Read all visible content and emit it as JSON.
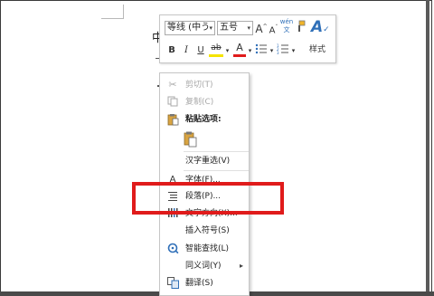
{
  "colors": {
    "highlight": "#e01b1b",
    "styles_accent": "#2f6fb8",
    "font_color_underline": "#e01b1b",
    "highlight_color_underline": "#f5e400"
  },
  "document": {
    "visible_char": "中"
  },
  "mini_toolbar": {
    "font_name": "等线 (中う",
    "font_size": "五号",
    "grow_font_icon": "A",
    "shrink_font_icon": "A",
    "phonetic_icon": "wén文",
    "format_painter_icon": "brush-icon",
    "styles_label": "样式",
    "bold": "B",
    "italic": "I",
    "underline": "U",
    "highlight_icon": "ab",
    "font_color_icon": "A",
    "bullets_icon": "bullets-icon",
    "numbering_icon": "numbering-icon"
  },
  "context_menu": {
    "items": [
      {
        "label": "剪切(T)",
        "icon": "cut-icon",
        "disabled": true
      },
      {
        "label": "复制(C)",
        "icon": "copy-icon",
        "disabled": true
      },
      {
        "label": "粘贴选项:",
        "icon": "paste-icon",
        "bold": true
      },
      {
        "label": "",
        "icon": "paste-keep-text-icon"
      },
      {
        "label": "汉字重选(V)",
        "icon": ""
      },
      {
        "label": "字体(F)...",
        "icon": "font-icon"
      },
      {
        "label": "段落(P)...",
        "icon": "paragraph-icon"
      },
      {
        "label": "文字方向(X)...",
        "icon": "text-direction-icon"
      },
      {
        "label": "插入符号(S)",
        "icon": ""
      },
      {
        "label": "智能查找(L)",
        "icon": "smart-lookup-icon"
      },
      {
        "label": "同义词(Y)",
        "icon": "",
        "submenu": true
      },
      {
        "label": "翻译(S)",
        "icon": "translate-icon"
      }
    ]
  }
}
